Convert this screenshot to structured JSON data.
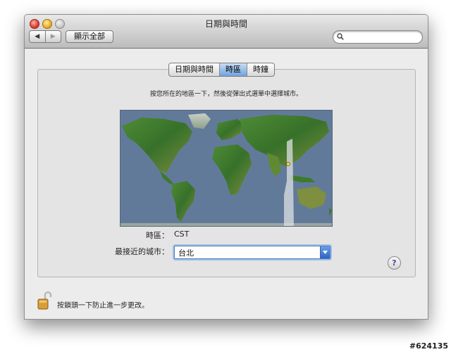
{
  "window": {
    "title": "日期與時間",
    "show_all_label": "顯示全部",
    "search": {
      "placeholder": "",
      "value": ""
    }
  },
  "tabs": [
    {
      "label": "日期與時間",
      "active": false
    },
    {
      "label": "時區",
      "active": true
    },
    {
      "label": "時鐘",
      "active": false
    }
  ],
  "timezone_pane": {
    "instruction": "按您所在的地區一下，然後從彈出式選單中選擇城市。",
    "timezone_label": "時區：",
    "timezone_value": "CST",
    "closest_city_label": "最接近的城市：",
    "closest_city_value": "台北"
  },
  "help_label": "?",
  "lock_text": "按鎖頭一下防止進一步更改。",
  "watermark": "#624135",
  "colors": {
    "selected_tab": "#6fa2de",
    "ocean": "#627a99",
    "land": "#3f7d2f",
    "timezone_band": "#d8dbe2"
  },
  "icons": {
    "back": "left-triangle",
    "forward": "right-triangle",
    "search": "magnifier",
    "lock": "padlock-open",
    "help": "question-mark"
  }
}
